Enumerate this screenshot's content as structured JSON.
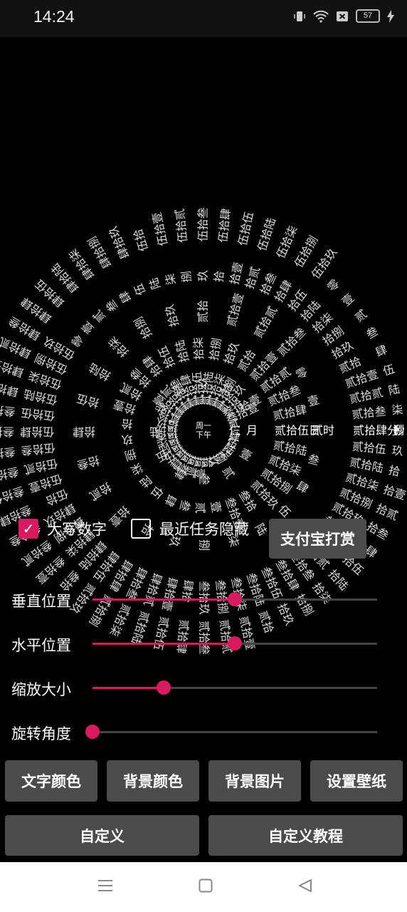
{
  "status_bar": {
    "time": "14:24",
    "battery": "57",
    "icons": [
      "vibrate-icon",
      "wifi-icon",
      "sim-off-icon",
      "battery-icon",
      "charging-icon"
    ]
  },
  "clock": {
    "colors": {
      "text": "#dcdcdc"
    },
    "center": [
      "周一",
      "下午"
    ],
    "rings": [
      {
        "unit": "",
        "values": [
          "仨",
          "肆",
          "伍",
          "陆",
          "柒",
          "捌",
          "玖",
          "拾",
          "拾壹",
          "拾贰",
          "拾叁",
          "拾肆",
          "拾伍",
          "拾陆",
          "拾柒",
          "拾捌",
          "拾玖",
          "贰拾",
          "贰拾壹",
          "贰拾贰",
          "贰拾叁",
          "贰拾肆",
          "贰拾伍",
          "贰拾陆",
          "贰拾柒",
          "贰拾捌",
          "贰拾玖",
          "叁拾",
          "叁拾壹",
          "贰"
        ],
        "current": 0
      },
      {
        "unit": "月",
        "values": [
          "月",
          "壹",
          "贰",
          "叁",
          "肆",
          "伍",
          "陆",
          "柒",
          "捌",
          "玖",
          "拾",
          "拾壹"
        ],
        "current": 0
      },
      {
        "unit": "日",
        "values": [
          "贰拾伍日",
          "贰拾陆",
          "贰拾柒",
          "贰拾捌",
          "贰拾玖",
          "叁拾",
          "叁拾壹",
          "壹",
          "贰",
          "叁",
          "肆",
          "伍",
          "陆",
          "柒",
          "捌",
          "玖",
          "拾",
          "拾壹",
          "拾贰",
          "拾叁",
          "拾肆",
          "拾伍",
          "拾陆",
          "拾柒",
          "拾捌",
          "拾玖",
          "贰拾",
          "贰拾壹",
          "贰拾贰",
          "贰拾叁",
          "贰拾肆"
        ],
        "current": 0
      },
      {
        "unit": "时",
        "values": [
          "贰时",
          "叁",
          "肆",
          "伍",
          "陆",
          "柒",
          "捌",
          "玖",
          "拾",
          "拾壹",
          "拾贰",
          "拾叁",
          "拾肆",
          "拾伍",
          "拾陆",
          "拾柒",
          "拾捌",
          "拾玖",
          "贰拾",
          "贰拾壹",
          "贰拾贰",
          "贰拾叁",
          "零",
          "壹"
        ],
        "current": 0
      },
      {
        "unit": "分",
        "values": [
          "贰拾肆分",
          "贰拾伍",
          "贰拾陆",
          "贰拾柒",
          "贰拾捌",
          "贰拾玖",
          "叁拾",
          "叁拾壹",
          "叁拾贰",
          "叁拾叁",
          "叁拾肆",
          "叁拾伍",
          "叁拾陆",
          "叁拾柒",
          "叁拾捌",
          "叁拾玖",
          "肆拾",
          "肆拾壹",
          "肆拾贰",
          "肆拾叁",
          "肆拾肆",
          "肆拾伍",
          "肆拾陆",
          "肆拾柒",
          "肆拾捌",
          "肆拾玖",
          "伍拾",
          "伍拾壹",
          "伍拾贰",
          "伍拾叁",
          "伍拾肆",
          "伍拾伍",
          "伍拾陆",
          "伍拾柒",
          "伍拾捌",
          "伍拾玖",
          "零",
          "壹",
          "贰",
          "叁",
          "肆",
          "伍",
          "陆",
          "柒",
          "捌",
          "玖",
          "拾",
          "拾壹",
          "拾贰",
          "拾叁",
          "拾肆",
          "拾伍",
          "拾陆",
          "拾柒",
          "拾捌",
          "拾玖",
          "贰拾",
          "贰拾壹",
          "贰拾贰",
          "贰拾叁"
        ],
        "current": 0
      },
      {
        "unit": "秒",
        "values": [
          "捌",
          "玖",
          "拾",
          "拾壹",
          "拾贰",
          "拾叁",
          "拾肆",
          "拾伍",
          "拾陆",
          "拾柒",
          "拾捌",
          "拾玖",
          "贰拾",
          "贰拾壹",
          "贰拾贰",
          "贰拾叁",
          "贰拾肆",
          "贰拾伍",
          "贰拾陆",
          "贰拾柒",
          "贰拾捌",
          "贰拾玖",
          "叁拾",
          "叁拾壹",
          "叁拾贰",
          "叁拾叁",
          "叁拾肆",
          "叁拾伍",
          "叁拾陆",
          "叁拾柒",
          "叁拾捌",
          "叁拾玖",
          "肆拾",
          "肆拾壹",
          "肆拾贰",
          "肆拾叁",
          "肆拾肆",
          "肆拾伍",
          "肆拾陆",
          "肆拾柒",
          "肆拾捌",
          "肆拾玖",
          "伍拾",
          "伍拾壹",
          "伍拾贰",
          "伍拾叁",
          "伍拾肆",
          "伍拾伍",
          "伍拾陆",
          "伍拾柒",
          "伍拾捌",
          "伍拾玖",
          "零",
          "壹",
          "贰",
          "叁",
          "肆",
          "伍",
          "陆",
          "柒"
        ],
        "current_label": "捌",
        "current": 0
      }
    ]
  },
  "options": {
    "uppercase_label": "大写数字",
    "uppercase_checked": true,
    "hide_recent_label": "最近任务隐藏",
    "hide_recent_checked": false,
    "alipay_button": "支付宝打赏",
    "check_mark": "✓"
  },
  "sliders": [
    {
      "label": "垂直位置",
      "value": 0.5
    },
    {
      "label": "水平位置",
      "value": 0.5
    },
    {
      "label": "缩放大小",
      "value": 0.25
    },
    {
      "label": "旋转角度",
      "value": 0.0
    }
  ],
  "buttons_row1": [
    "文字颜色",
    "背景颜色",
    "背景图片",
    "设置壁纸"
  ],
  "buttons_row2": [
    "自定义",
    "自定义教程"
  ],
  "accent_color": "#d81b60"
}
